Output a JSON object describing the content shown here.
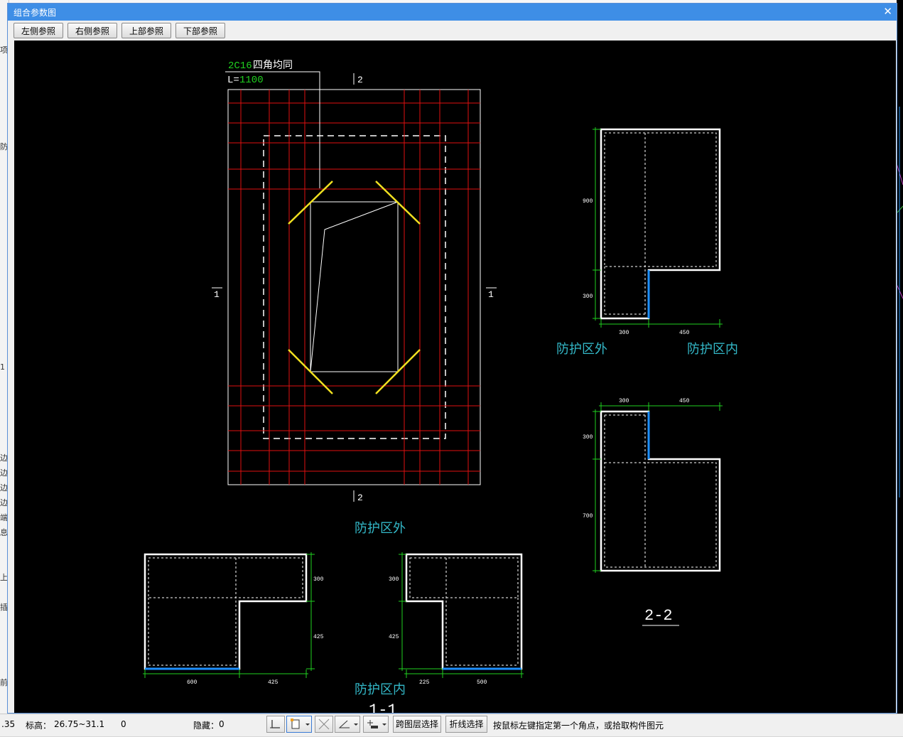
{
  "dialog": {
    "title": "组合参数图",
    "close_glyph": "✕",
    "toolbar": {
      "buttons": [
        "左侧参照",
        "右侧参照",
        "上部参照",
        "下部参照"
      ]
    }
  },
  "drawing": {
    "rebar_label": "2C16",
    "rebar_note": "四角均同",
    "length_prefix": "L=",
    "length_value": "1100",
    "section_mark_2_top": "2",
    "section_mark_2_bottom": "2",
    "section_mark_1_left": "1",
    "section_mark_1_right": "1",
    "label_outside_main": "防护区外",
    "label_outside_right": "防护区外",
    "label_inside_right": "防护区内",
    "label_inside_bottom": "防护区内",
    "section_title_22": "2-2",
    "section_title_11": "1-1",
    "dims": {
      "s1_900": "900",
      "s1_300v": "300",
      "s1_300h": "300",
      "s1_450h": "450",
      "s2_300h": "300",
      "s2_450h": "450",
      "s2_300v": "300",
      "s2_700v": "700",
      "b1_300v": "300",
      "b1_425v": "425",
      "b1_600h": "600",
      "b1_425h": "425",
      "b2_300v": "300",
      "b2_425v": "425",
      "b2_225h": "225",
      "b2_500h": "500"
    },
    "colors": {
      "background": "#000000",
      "rebar_red": "#e01010",
      "outline_white": "#ffffff",
      "corner_yellow": "#f0e020",
      "dim_green": "#20d020",
      "text_cyan": "#33b8c8",
      "edge_blue": "#1e90ff"
    }
  },
  "statusbar": {
    "coord_partial": ".35",
    "elev_label": "标高：",
    "elev_value": "26.75~31.1",
    "count_value": "0",
    "hidden_label": "隐藏：",
    "hidden_value": "0",
    "btn_cross_layer": "跨图层选择",
    "btn_polyline": "折线选择",
    "hint": "按鼠标左键指定第一个角点，或拾取构件图元"
  },
  "background": {
    "left_fragments": [
      "项",
      "防",
      "1",
      "边",
      "边",
      "边",
      "边",
      "端",
      "息",
      "上",
      "插",
      "插",
      "前"
    ]
  }
}
